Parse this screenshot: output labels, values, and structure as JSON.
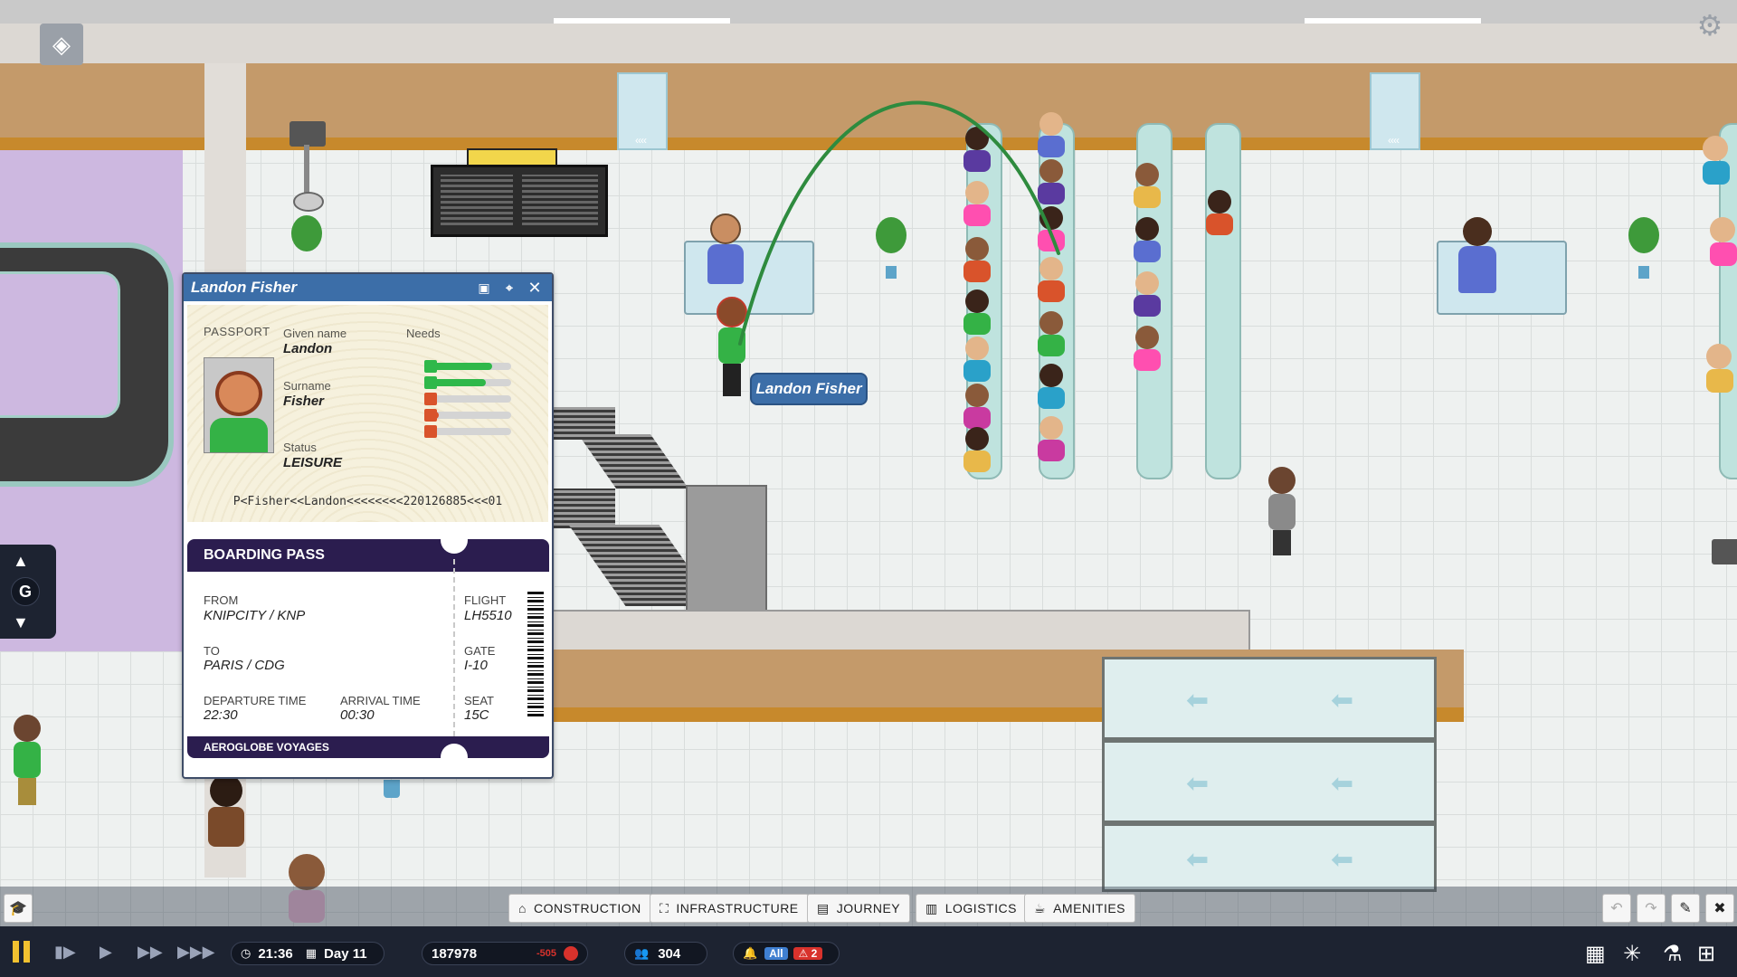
{
  "passenger": {
    "name": "Landon Fisher",
    "given_name_label": "Given name",
    "given_name": "Landon",
    "surname_label": "Surname",
    "surname": "Fisher",
    "status_label": "Status",
    "status": "LEISURE",
    "passport_label": "PASSPORT",
    "needs_label": "Needs",
    "needs": [
      {
        "level": 0.78,
        "color": "#2fb84a"
      },
      {
        "level": 0.7,
        "color": "#2fb84a"
      },
      {
        "level": 0.1,
        "color": "#d9532b"
      },
      {
        "level": 0.15,
        "color": "#d9532b"
      },
      {
        "level": 0.08,
        "color": "#d9532b"
      }
    ],
    "mrz": "P<Fisher<<Landon<<<<<<<<220126885<<<01"
  },
  "boarding_pass": {
    "title": "BOARDING PASS",
    "from_label": "FROM",
    "from": "KNIPCITY / KNP",
    "to_label": "TO",
    "to": "PARIS / CDG",
    "departure_label": "DEPARTURE TIME",
    "departure": "22:30",
    "arrival_label": "ARRIVAL TIME",
    "arrival": "00:30",
    "flight_label": "FLIGHT",
    "flight": "LH5510",
    "gate_label": "GATE",
    "gate": "I-10",
    "seat_label": "SEAT",
    "seat": "15C",
    "airline": "AEROGLOBE VOYAGES"
  },
  "floor_label": "G",
  "toolbar": {
    "categories": [
      {
        "label": "CONSTRUCTION",
        "icon": "crane-icon"
      },
      {
        "label": "INFRASTRUCTURE",
        "icon": "road-icon"
      },
      {
        "label": "JOURNEY",
        "icon": "ticket-icon"
      },
      {
        "label": "LOGISTICS",
        "icon": "luggage-icon"
      },
      {
        "label": "AMENITIES",
        "icon": "coffee-icon"
      }
    ]
  },
  "status": {
    "time": "21:36",
    "day": "Day 11",
    "money": "187978",
    "money_delta": "-505",
    "passengers": "304",
    "notif_filter": "All",
    "alerts": "2"
  },
  "colors": {
    "panel_header": "#3c6ea8",
    "boarding_pass": "#2b1d4f",
    "statusbar": "#1d2331",
    "path": "#2e8b3e",
    "alert": "#d8322c"
  }
}
